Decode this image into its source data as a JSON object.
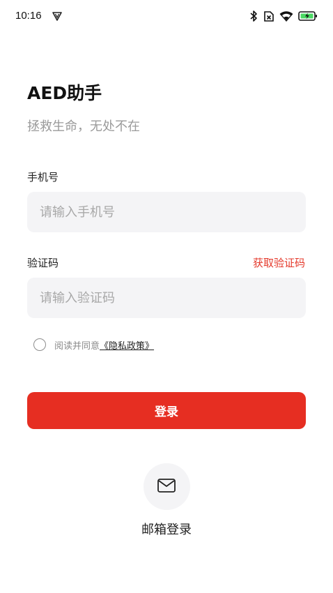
{
  "status_bar": {
    "time": "10:16",
    "icons": [
      "notification-icon",
      "bluetooth-icon",
      "no-sim-icon",
      "wifi-icon",
      "battery-charging-icon"
    ]
  },
  "header": {
    "title": "AED助手",
    "subtitle": "拯救生命，无处不在"
  },
  "phone": {
    "label": "手机号",
    "placeholder": "请输入手机号"
  },
  "code": {
    "label": "验证码",
    "placeholder": "请输入验证码",
    "get_code": "获取验证码"
  },
  "agreement": {
    "text": "阅读并同意",
    "policy": "《隐私政策》"
  },
  "login": {
    "label": "登录"
  },
  "email_login": {
    "label": "邮箱登录",
    "icon": "mail-icon"
  },
  "colors": {
    "accent": "#e62e22",
    "link": "#e4392b",
    "input_bg": "#f4f4f6"
  }
}
